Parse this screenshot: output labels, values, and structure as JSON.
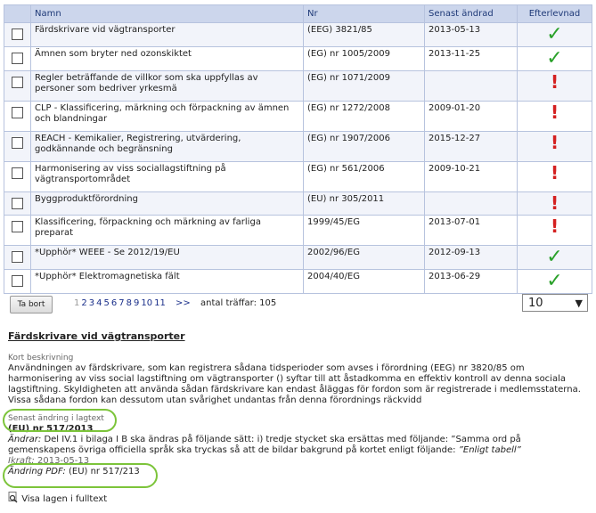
{
  "table": {
    "headers": {
      "name": "Namn",
      "nr": "Nr",
      "changed": "Senast ändrad",
      "comply": "Efterlevnad"
    },
    "rows": [
      {
        "name": "Färdskrivare vid vägtransporter",
        "nr": "(EEG) 3821/85",
        "changed": "2013-05-13",
        "status": "ok"
      },
      {
        "name": "Ämnen som bryter ned ozonskiktet",
        "nr": "(EG) nr 1005/2009",
        "changed": "2013-11-25",
        "status": "ok"
      },
      {
        "name": "Regler beträffande de villkor som ska uppfyllas av personer som bedriver yrkesmä",
        "nr": "(EG) nr 1071/2009",
        "changed": "",
        "status": "warn"
      },
      {
        "name": "CLP - Klassificering, märkning och förpackning av ämnen och blandningar",
        "nr": "(EG) nr 1272/2008",
        "changed": "2009-01-20",
        "status": "warn"
      },
      {
        "name": "REACH - Kemikalier, Registrering, utvärdering, godkännande och begränsning",
        "nr": "(EG) nr 1907/2006",
        "changed": "2015-12-27",
        "status": "warn"
      },
      {
        "name": "Harmonisering av viss sociallagstiftning på vägtransportområdet",
        "nr": "(EG) nr 561/2006",
        "changed": "2009-10-21",
        "status": "warn"
      },
      {
        "name": "Byggproduktförordning",
        "nr": "(EU) nr 305/2011",
        "changed": "",
        "status": "warn"
      },
      {
        "name": "Klassificering, förpackning och märkning av farliga preparat",
        "nr": "1999/45/EG",
        "changed": "2013-07-01",
        "status": "warn"
      },
      {
        "name": "*Upphör* WEEE - Se 2012/19/EU",
        "nr": "2002/96/EG",
        "changed": "2012-09-13",
        "status": "ok"
      },
      {
        "name": "*Upphör* Elektromagnetiska fält",
        "nr": "2004/40/EG",
        "changed": "2013-06-29",
        "status": "ok"
      }
    ]
  },
  "pager": {
    "delete_label": "Ta bort",
    "pages": [
      "1",
      "2",
      "3",
      "4",
      "5",
      "6",
      "7",
      "8",
      "9",
      "10",
      "11"
    ],
    "next": ">>",
    "hits": "antal träffar: 105",
    "per_page": "10"
  },
  "detail": {
    "title": "Färdskrivare vid vägtransporter",
    "short_label": "Kort beskrivning",
    "short_text": "Användningen av färdskrivare, som kan registrera sådana tidsperioder som avses i förordning (EEG) nr 3820/85 om harmonisering av viss social lagstiftning om vägtransporter () syftar till att åstadkomma en effektiv kontroll av denna sociala lagstiftning. Skyldigheten att använda sådan färdskrivare kan endast åläggas för fordon som är registrerade i medlemsstaterna. Vissa sådana fordon kan dessutom utan svårighet undantas från denna förordnings räckvidd",
    "latest_label": "Senast ändring i lagtext",
    "latest_value": "(EU) nr 517/2013",
    "change_label": "Ändrar:",
    "change_text": "Del IV.1 i bilaga I B ska ändras på följande sätt: i) tredje stycket ska ersättas med följande: ”Samma ord på gemenskapens övriga officiella språk ska tryckas så att de bildar bakgrund på kortet enligt följande:",
    "change_quote": "”Enligt tabell”",
    "force_label": "Ikraft:",
    "force_value": "2013-05-13",
    "pdf_label": "Ändring PDF:",
    "pdf_value": "(EU) nr 517/213",
    "fulltext_label": "Visa lagen i fulltext"
  },
  "colors": {
    "ok": "#2aa12a",
    "warn": "#d42020",
    "highlight": "#7cc43a"
  },
  "icons": {
    "ok": "check-icon",
    "warn": "exclamation-icon",
    "fulltext": "magnifier-document-icon"
  }
}
